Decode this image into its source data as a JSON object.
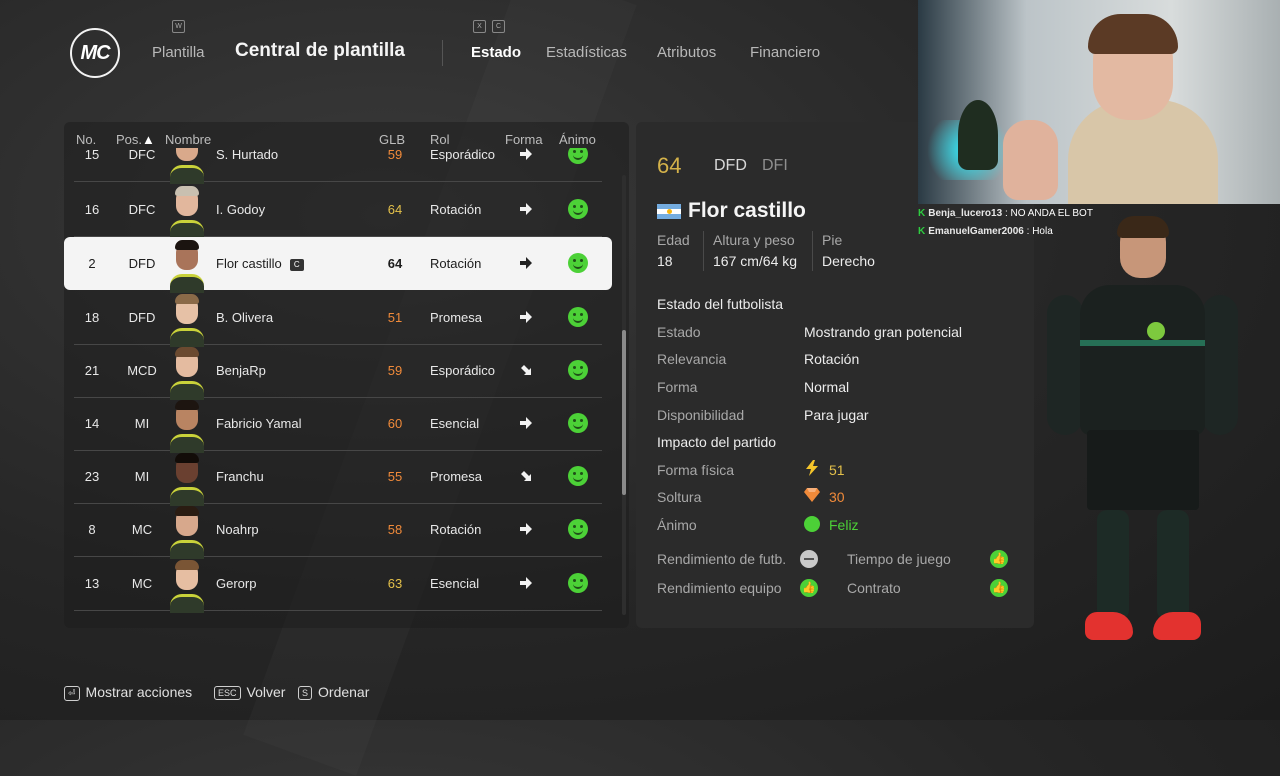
{
  "nav": {
    "logo": "MC",
    "plantilla": "Plantilla",
    "title": "Central de plantilla",
    "key_w": "W",
    "key_x": "X",
    "key_c": "C",
    "tabs": [
      {
        "label": "Estado",
        "active": true
      },
      {
        "label": "Estadísticas",
        "active": false
      },
      {
        "label": "Atributos",
        "active": false
      },
      {
        "label": "Financiero",
        "active": false
      }
    ]
  },
  "table": {
    "headers": {
      "no": "No.",
      "pos": "Pos.",
      "nombre": "Nombre",
      "glb": "GLB",
      "rol": "Rol",
      "forma": "Forma",
      "animo": "Ánimo"
    },
    "captain_badge": "C",
    "rows": [
      {
        "no": "15",
        "pos": "DFC",
        "name": "S. Hurtado",
        "glb": "59",
        "rol": "Esporádico",
        "glb_color": "#f08a3a",
        "forma": "right",
        "skin": "#d9a98b",
        "hair": "#3b2a1a"
      },
      {
        "no": "16",
        "pos": "DFC",
        "name": "I. Godoy",
        "glb": "64",
        "rol": "Rotación",
        "glb_color": "#e3c04a",
        "forma": "right",
        "skin": "#e2b79d",
        "hair": "#c9c0b0"
      },
      {
        "no": "2",
        "pos": "DFD",
        "name": "Flor castillo",
        "glb": "64",
        "rol": "Rotación",
        "glb_color": "#1c1c1c",
        "forma": "right",
        "skin": "#a9745a",
        "hair": "#1b1410",
        "selected": true,
        "captain": true
      },
      {
        "no": "18",
        "pos": "DFD",
        "name": "B. Olivera",
        "glb": "51",
        "rol": "Promesa",
        "glb_color": "#f08a3a",
        "forma": "right",
        "skin": "#e6c1a6",
        "hair": "#8a6a48"
      },
      {
        "no": "21",
        "pos": "MCD",
        "name": "BenjaRp",
        "glb": "59",
        "rol": "Esporádico",
        "glb_color": "#f08a3a",
        "forma": "down-right",
        "skin": "#e4bba0",
        "hair": "#6b4a30"
      },
      {
        "no": "14",
        "pos": "MI",
        "name": "Fabricio Yamal",
        "glb": "60",
        "rol": "Esencial",
        "glb_color": "#f08a3a",
        "forma": "right",
        "skin": "#b98462",
        "hair": "#1d1510"
      },
      {
        "no": "23",
        "pos": "MI",
        "name": "Franchu",
        "glb": "55",
        "rol": "Promesa",
        "glb_color": "#f08a3a",
        "forma": "down-right",
        "skin": "#6a4030",
        "hair": "#120c08"
      },
      {
        "no": "8",
        "pos": "MC",
        "name": "Noahrp",
        "glb": "58",
        "rol": "Rotación",
        "glb_color": "#f08a3a",
        "forma": "right",
        "skin": "#d7a88c",
        "hair": "#2a1c12"
      },
      {
        "no": "13",
        "pos": "MC",
        "name": "Gerorp",
        "glb": "63",
        "rol": "Esencial",
        "glb_color": "#e3c04a",
        "forma": "right",
        "skin": "#e6bea2",
        "hair": "#7a5535"
      }
    ]
  },
  "detail": {
    "ovr": "64",
    "pos_primary": "DFD",
    "pos_secondary": "DFI",
    "name": "Flor castillo",
    "edad_label": "Edad",
    "edad": "18",
    "altura_label": "Altura y peso",
    "altura": "167 cm/64 kg",
    "pie_label": "Pie",
    "pie": "Derecho",
    "section_estado": "Estado del futbolista",
    "estado_label": "Estado",
    "estado": "Mostrando gran potencial",
    "relevancia_label": "Relevancia",
    "relevancia": "Rotación",
    "forma_label": "Forma",
    "forma": "Normal",
    "disponibilidad_label": "Disponibilidad",
    "disponibilidad": "Para jugar",
    "section_impacto": "Impacto del partido",
    "forma_fisica_label": "Forma física",
    "forma_fisica": "51",
    "soltura_label": "Soltura",
    "soltura": "30",
    "animo_label": "Ánimo",
    "animo": "Feliz",
    "rend_futb_label": "Rendimiento de futb.",
    "tiempo_label": "Tiempo de juego",
    "rend_equipo_label": "Rendimiento equipo",
    "contrato_label": "Contrato",
    "colors": {
      "ovr": "#d4b24a",
      "forma_fisica": "#e3c04a",
      "soltura": "#f08a3a",
      "animo": "#4cd137"
    }
  },
  "chat": [
    {
      "user": "Benja_lucero13",
      "msg": " : NO ANDA EL BOT"
    },
    {
      "user": "EmanuelGamer2006",
      "msg": " : Hola"
    }
  ],
  "actions": {
    "mostrar_key": "⏎",
    "mostrar": "Mostrar acciones",
    "volver_key": "ESC",
    "volver": "Volver",
    "ordenar_key": "S",
    "ordenar": "Ordenar"
  }
}
